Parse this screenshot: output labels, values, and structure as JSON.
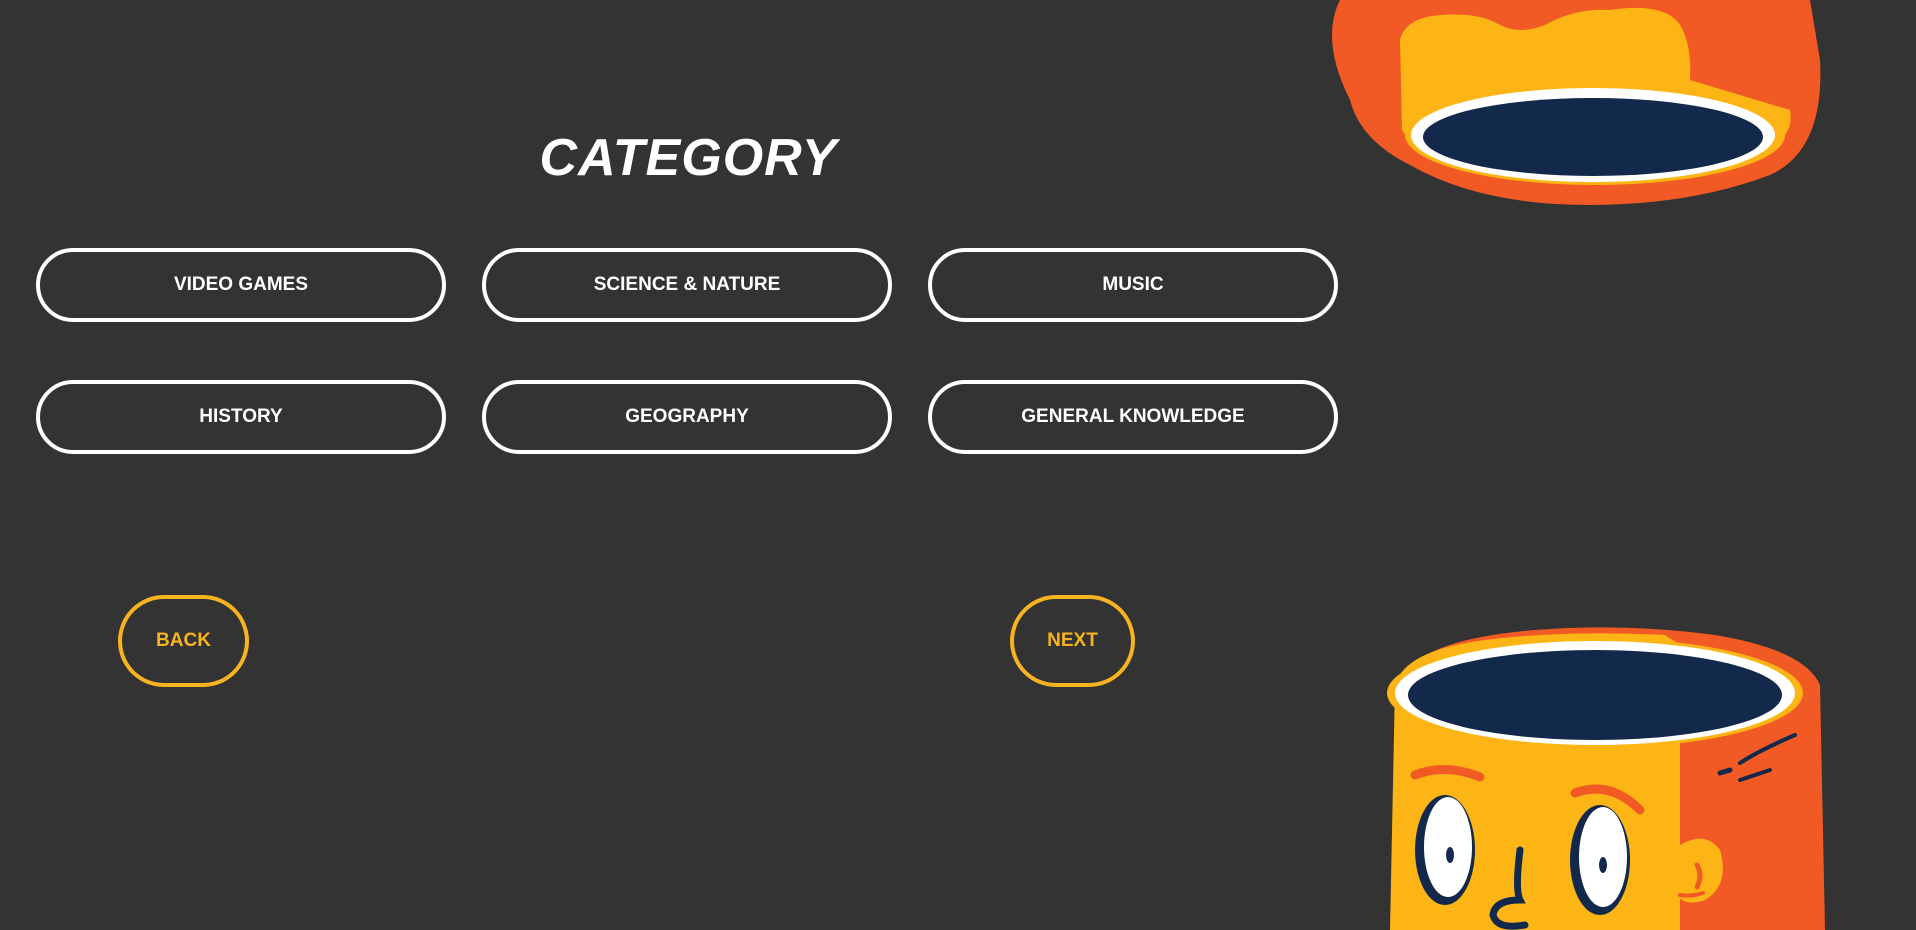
{
  "title": "CATEGORY",
  "categories": [
    {
      "label": "VIDEO GAMES"
    },
    {
      "label": "SCIENCE & NATURE"
    },
    {
      "label": "MUSIC"
    },
    {
      "label": "HISTORY"
    },
    {
      "label": "GEOGRAPHY"
    },
    {
      "label": "GENERAL KNOWLEDGE"
    }
  ],
  "navigation": {
    "back_label": "BACK",
    "next_label": "NEXT"
  },
  "colors": {
    "background": "#333333",
    "button_border": "#ffffff",
    "nav_accent": "#f7b320",
    "mascot_orange": "#f15a24",
    "mascot_yellow": "#fdb515",
    "mascot_navy": "#13294b"
  },
  "illustrations": [
    "cup-top-illustration",
    "cup-face-illustration"
  ]
}
